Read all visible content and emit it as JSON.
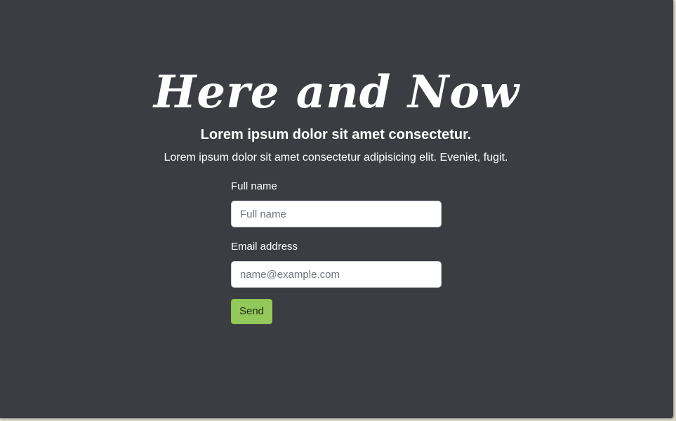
{
  "hero": {
    "title": "Here and Now",
    "subtitle": "Lorem ipsum dolor sit amet consectetur.",
    "lead": "Lorem ipsum dolor sit amet consectetur adipisicing elit. Eveniet, fugit."
  },
  "form": {
    "full_name": {
      "label": "Full name",
      "placeholder": "Full name",
      "value": ""
    },
    "email": {
      "label": "Email address",
      "placeholder": "name@example.com",
      "value": ""
    },
    "submit_label": "Send"
  },
  "colors": {
    "background": "#3c3d43",
    "accent": "#93c95a",
    "text": "#ffffff"
  }
}
